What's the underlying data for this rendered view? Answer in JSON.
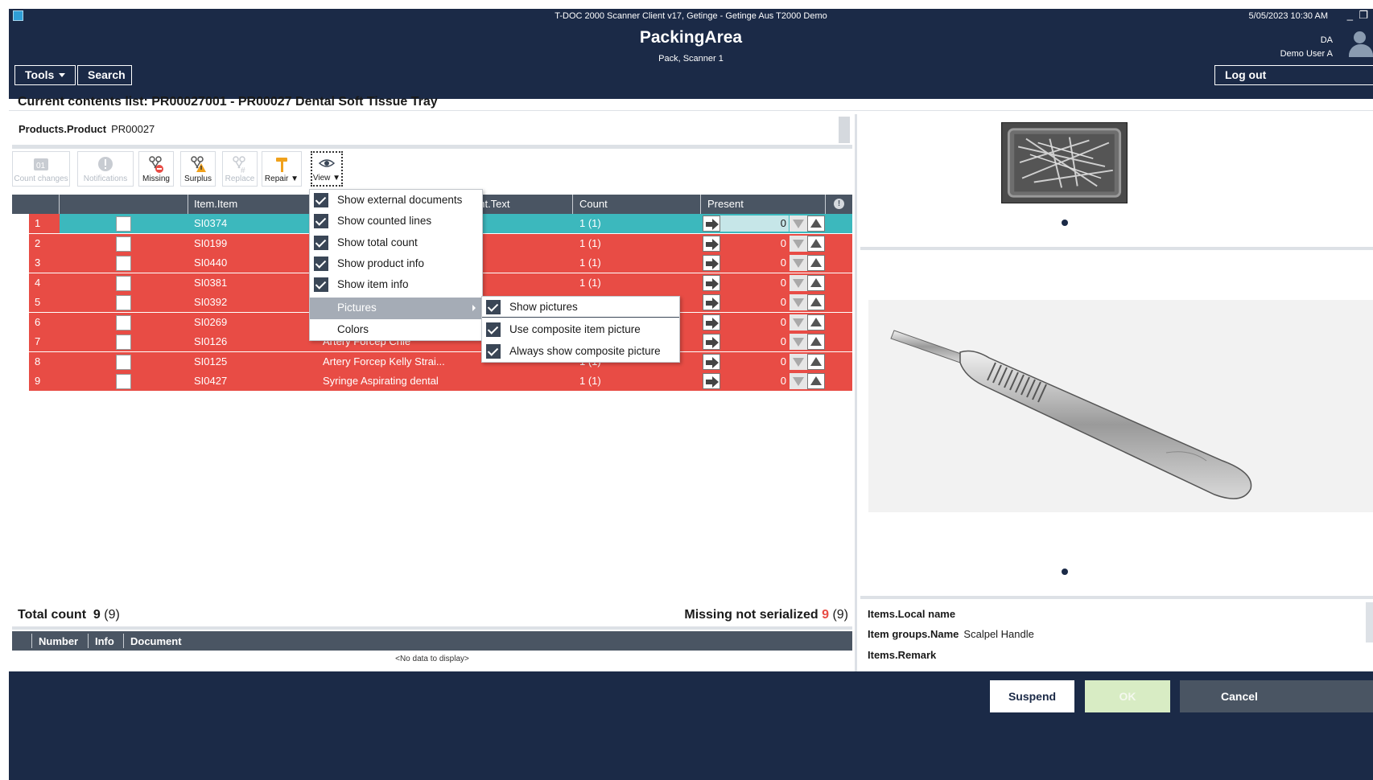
{
  "window": {
    "title": "T-DOC 2000 Scanner Client v17, Getinge - Getinge Aus T2000 Demo",
    "datetime": "5/05/2023 10:30 AM",
    "min_label": "_",
    "restore_label": "❐"
  },
  "app": {
    "title": "PackingArea",
    "subtitle": "Pack, Scanner 1"
  },
  "user": {
    "initials": "DA",
    "name": "Demo User A"
  },
  "header_buttons": {
    "tools": "Tools",
    "search": "Search",
    "logout": "Log out"
  },
  "contents_list": {
    "label": "Current contents list: PR00027001 - PR00027 Dental Soft Tissue Tray"
  },
  "product": {
    "label": "Products.Product",
    "value": "PR00027"
  },
  "toolbar": {
    "count_changes": "Count changes",
    "notifications": "Notifications",
    "missing": "Missing",
    "surplus": "Surplus",
    "replace": "Replace",
    "repair": "Repair ▼",
    "view": "View ▼"
  },
  "grid": {
    "columns": [
      "Item.Item",
      "ent.Text",
      "Count",
      "Present"
    ],
    "rows": [
      {
        "n": "1",
        "item": "SI0374",
        "text": "",
        "count": "1 (1)",
        "present": "0"
      },
      {
        "n": "2",
        "item": "SI0199",
        "text": "",
        "count": "1 (1)",
        "present": "0"
      },
      {
        "n": "3",
        "item": "SI0440",
        "text": "",
        "count": "1 (1)",
        "present": "0"
      },
      {
        "n": "4",
        "item": "SI0381",
        "text": "",
        "count": "1 (1)",
        "present": "0"
      },
      {
        "n": "5",
        "item": "SI0392",
        "text": "",
        "count": "",
        "present": "0"
      },
      {
        "n": "6",
        "item": "SI0269",
        "text": "",
        "count": "",
        "present": "0"
      },
      {
        "n": "7",
        "item": "SI0126",
        "text": "Artery Forcep Crile",
        "count": "",
        "present": "0"
      },
      {
        "n": "8",
        "item": "SI0125",
        "text": "Artery Forcep Kelly Strai...",
        "count": "1 (1)",
        "present": "0"
      },
      {
        "n": "9",
        "item": "SI0427",
        "text": "Syringe Aspirating dental",
        "count": "1 (1)",
        "present": "0"
      }
    ]
  },
  "view_menu": {
    "items": [
      "Show external documents",
      "Show counted lines",
      "Show total count",
      "Show product info",
      "Show item info"
    ],
    "pictures": "Pictures",
    "colors": "Colors"
  },
  "pictures_submenu": {
    "items": [
      "Show pictures",
      "Use composite item picture",
      "Always show composite picture"
    ]
  },
  "totals": {
    "total_label": "Total count",
    "total_value": "9",
    "total_paren": "(9)",
    "missing_label": "Missing not serialized",
    "missing_value": "9",
    "missing_paren": "(9)"
  },
  "documents": {
    "columns": [
      "Number",
      "Info",
      "Document"
    ],
    "empty": "<No data to display>"
  },
  "item_info": {
    "local_name_label": "Items.Local name",
    "group_label": "Item groups.Name",
    "group_value": "Scalpel Handle",
    "remark_label": "Items.Remark"
  },
  "footer": {
    "suspend": "Suspend",
    "ok": "OK",
    "cancel": "Cancel"
  },
  "colors": {
    "header": "#1b2a47",
    "row_missing": "#e84c45",
    "row_selected": "#3cb8bd",
    "grid_header": "#4a5563"
  }
}
